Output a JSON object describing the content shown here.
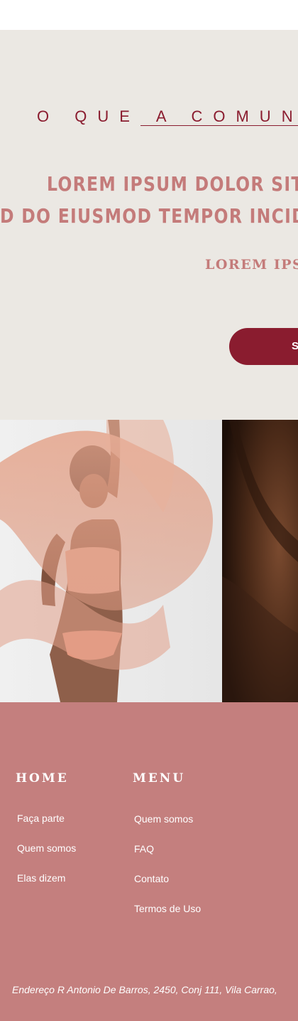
{
  "hero": {
    "eyebrow_part1": "O QUE",
    "eyebrow_part2": "A COMUN",
    "headline_line1": "LOREM IPSUM DOLOR SIT A",
    "headline_line2": "D DO EIUSMOD TEMPOR INCIDID",
    "subheadline": "LOREM IPS",
    "cta_label": "S"
  },
  "gallery": {
    "photos": [
      {
        "name": "woman-with-pink-fabric-photo"
      },
      {
        "name": "skin-closeup-photo"
      }
    ]
  },
  "footer": {
    "home": {
      "title": "HOME",
      "links": [
        "Faça parte",
        "Quem somos",
        "Elas dizem"
      ]
    },
    "menu": {
      "title": "MENU",
      "links": [
        "Quem somos",
        "FAQ",
        "Contato",
        "Termos de Uso"
      ]
    },
    "address": "Endereço R Antonio De Barros, 2450, Conj 111, Vila Carrao,"
  },
  "colors": {
    "hero_background": "#ebe8e3",
    "brand_wine": "#8a1c2f",
    "rose_text": "#c47b7a",
    "footer_background": "#c47f7e",
    "white": "#ffffff"
  }
}
